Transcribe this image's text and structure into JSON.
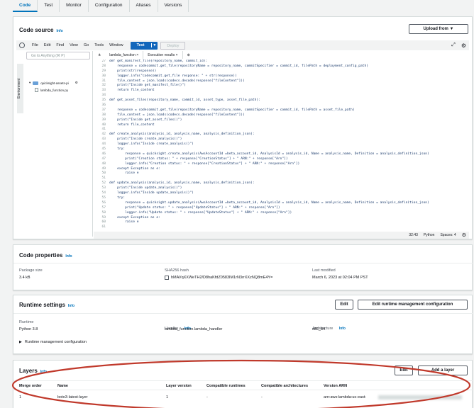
{
  "tabs": [
    {
      "label": "Code"
    },
    {
      "label": "Test"
    },
    {
      "label": "Monitor"
    },
    {
      "label": "Configuration"
    },
    {
      "label": "Aliases"
    },
    {
      "label": "Versions"
    }
  ],
  "code_source": {
    "title": "Code source",
    "info": "Info",
    "upload_label": "Upload from ▼",
    "menu": [
      "File",
      "Edit",
      "Find",
      "View",
      "Go",
      "Tools",
      "Window"
    ],
    "test_label": "Test",
    "deploy_label": "Deploy",
    "search_placeholder": "Go to Anything (⌘ P)",
    "environment_label": "Environment",
    "folder_label": "quicksight-assets-pi",
    "file_label": "lambda_function.py",
    "editor_tabs": [
      "lambda_function ×",
      "Execution results ×"
    ],
    "status": {
      "position": "32:43",
      "language": "Python",
      "spaces": "Spaces: 4"
    },
    "code": [
      {
        "n": "27",
        "t": "def get_manifest_file(repository_name, commit_id):"
      },
      {
        "n": "28",
        "t": "    response = codecommit.get_file(repositoryName = repository_name, commitSpecifier = commit_id, filePath = deployment_config_path)"
      },
      {
        "n": "29",
        "t": "    print(str(response))"
      },
      {
        "n": "30",
        "t": "    logger.info(\"codecommit.get_file response: \" + str(response))"
      },
      {
        "n": "31",
        "t": "    file_content = json.loads(codecs.decode(response[\"fileContent\"]))"
      },
      {
        "n": "32",
        "t": "    print(\"Inside get_manifest_file()\")"
      },
      {
        "n": "33",
        "t": "    return file_content"
      },
      {
        "n": "34",
        "t": ""
      },
      {
        "n": "35",
        "t": "def get_asset_files(repository_name, commit_id, asset_type, asset_file_path):"
      },
      {
        "n": "36",
        "t": ""
      },
      {
        "n": "37",
        "t": "    response = codecommit.get_file(repositoryName = repository_name, commitSpecifier = commit_id, filePath = asset_file_path)"
      },
      {
        "n": "38",
        "t": "    file_content = json.loads(codecs.decode(response[\"fileContent\"]))"
      },
      {
        "n": "39",
        "t": "    print(\"Inside get_asset_files()\")"
      },
      {
        "n": "40",
        "t": "    return file_content"
      },
      {
        "n": "41",
        "t": ""
      },
      {
        "n": "42",
        "t": "def create_analysis(analysis_id, analysis_name, analysis_definition_json):"
      },
      {
        "n": "43",
        "t": "    print(\"Inside create_analysis()\")"
      },
      {
        "n": "44",
        "t": "    logger.info(\"Inside create_analysis()\")"
      },
      {
        "n": "45",
        "t": "    try:"
      },
      {
        "n": "46",
        "t": "        response = quicksight.create_analysis(AwsAccountId =beta_account_id, AnalysisId = analysis_id, Name = analysis_name, Definition = analysis_definition_json)"
      },
      {
        "n": "47",
        "t": "        print(\"Creation status: \" + response[\"CreationStatus\"] + \" ARN:\" + response[\"Arn\"])"
      },
      {
        "n": "48",
        "t": "        logger.info(\"Creation status: \" + response[\"CreationStatus\"] + \" ARN:\" + response[\"Arn\"])"
      },
      {
        "n": "49",
        "t": "    except Exception as e:"
      },
      {
        "n": "50",
        "t": "        raise e"
      },
      {
        "n": "51",
        "t": ""
      },
      {
        "n": "52",
        "t": "def update_analysis(analysis_id, analysis_name, analysis_definition_json):"
      },
      {
        "n": "53",
        "t": "    print(\"Inside update_analysis()\")"
      },
      {
        "n": "54",
        "t": "    logger.info(\"Inside update_analysis()\")"
      },
      {
        "n": "55",
        "t": "    try:"
      },
      {
        "n": "56",
        "t": "        response = quicksight.update_analysis(AwsAccountId =beta_account_id, AnalysisId = analysis_id, Name = analysis_name, Definition = analysis_definition_json)"
      },
      {
        "n": "57",
        "t": "        print(\"Update status: \" + response[\"UpdateStatus\"] + \" ARN:\" + response[\"Arn\"])"
      },
      {
        "n": "58",
        "t": "        logger.info(\"Update status: \" + response[\"UpdateStatus\"] + \" ARN:\" + response[\"Arn\"])"
      },
      {
        "n": "59",
        "t": "    except Exception as e:"
      },
      {
        "n": "60",
        "t": "        raise e"
      },
      {
        "n": "61",
        "t": ""
      }
    ]
  },
  "code_properties": {
    "title": "Code properties",
    "info": "Info",
    "package_size_label": "Package size",
    "package_size": "3.4 kB",
    "sha_label": "SHA256 hash",
    "sha": "hMAVqXXWeTH2/D8haKfdZ0583IM1rN3rrXXzNQ8mE4Y=",
    "modified_label": "Last modified",
    "modified": "March 6, 2023 at 02:04 PM PST"
  },
  "runtime_settings": {
    "title": "Runtime settings",
    "info": "Info",
    "edit_label": "Edit",
    "edit_mgmt_label": "Edit runtime management configuration",
    "runtime_label": "Runtime",
    "runtime": "Python 3.8",
    "handler_label": "Handler",
    "handler_info": "Info",
    "handler": "lambda_function.lambda_handler",
    "arch_label": "Architecture",
    "arch_info": "Info",
    "arch": "x86_64",
    "mgmt_config": "Runtime management configuration"
  },
  "layers": {
    "title": "Layers",
    "info": "Info",
    "edit_label": "Edit",
    "add_label": "Add a layer",
    "columns": [
      "Merge order",
      "Name",
      "Layer version",
      "Compatible runtimes",
      "Compatible architectures",
      "Version ARN"
    ],
    "rows": [
      {
        "order": "1",
        "name": "boto3-latest-layer",
        "version": "1",
        "runtimes": "-",
        "archs": "-",
        "arn": "arn:aws:lambda:us-east-"
      }
    ]
  },
  "colors": {
    "accent": "#0073bb",
    "highlight": "#c0392b",
    "test_button": "#1166bb"
  }
}
